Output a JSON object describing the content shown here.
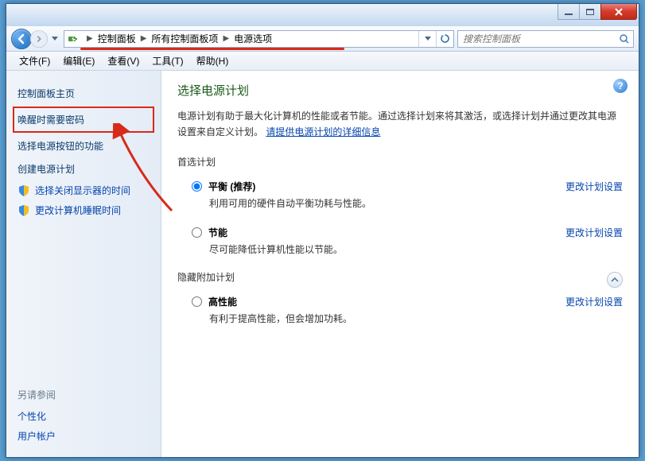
{
  "breadcrumb": {
    "items": [
      "控制面板",
      "所有控制面板项",
      "电源选项"
    ]
  },
  "search": {
    "placeholder": "搜索控制面板"
  },
  "menu": {
    "file": "文件(F)",
    "edit": "编辑(E)",
    "view": "查看(V)",
    "tools": "工具(T)",
    "help": "帮助(H)"
  },
  "sidebar": {
    "home": "控制面板主页",
    "require_password": "唤醒时需要密码",
    "power_button": "选择电源按钮的功能",
    "create_plan": "创建电源计划",
    "display_off": "选择关闭显示器的时间",
    "sleep_time": "更改计算机睡眠时间",
    "see_also_h": "另请参阅",
    "personalize": "个性化",
    "user_accounts": "用户帐户"
  },
  "main": {
    "title": "选择电源计划",
    "desc_pre": "电源计划有助于最大化计算机的性能或者节能。通过选择计划来将其激活，或选择计划并通过更改其电源设置来自定义计划。",
    "desc_link": "请提供电源计划的详细信息",
    "preferred_h": "首选计划",
    "change_link": "更改计划设置",
    "plan_balanced": {
      "name": "平衡 (推荐)",
      "desc": "利用可用的硬件自动平衡功耗与性能。"
    },
    "plan_saver": {
      "name": "节能",
      "desc": "尽可能降低计算机性能以节能。"
    },
    "hidden_h": "隐藏附加计划",
    "plan_high": {
      "name": "高性能",
      "desc": "有利于提高性能，但会增加功耗。"
    }
  }
}
